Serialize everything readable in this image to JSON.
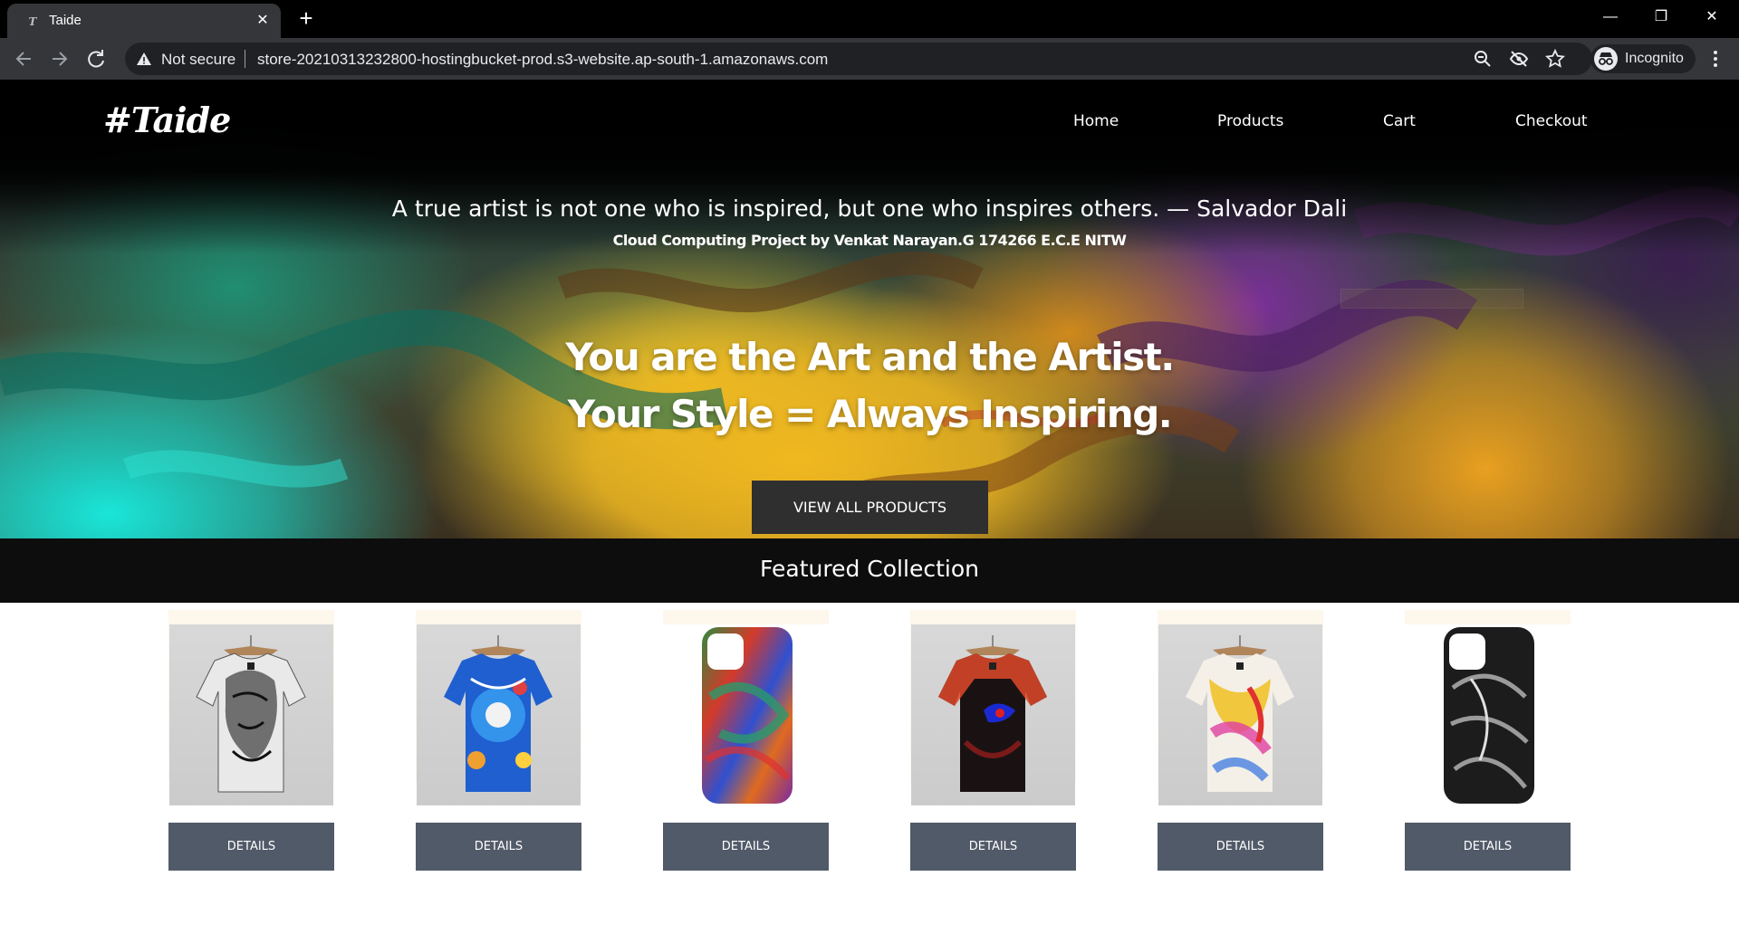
{
  "browser": {
    "tab_title": "Taide",
    "tab_favicon": "T",
    "close_tab": "✕",
    "new_tab": "+",
    "window_controls": {
      "minimize": "—",
      "restore": "❐",
      "close": "✕"
    },
    "security_label": "Not secure",
    "url": "store-20210313232800-hostingbucket-prod.s3-website.ap-south-1.amazonaws.com",
    "profile_label": "Incognito",
    "icons": [
      "back-arrow-icon",
      "forward-arrow-icon",
      "reload-icon",
      "warning-icon",
      "zoom-icon",
      "eye-off-icon",
      "star-icon",
      "incognito-icon",
      "more-menu-icon"
    ]
  },
  "site": {
    "logo": "#Taide",
    "nav": [
      "Home",
      "Products",
      "Cart",
      "Checkout"
    ],
    "hero": {
      "quote": "A true artist is not one who is inspired, but one who inspires others. — Salvador Dali",
      "credit": "Cloud Computing Project by Venkat Narayan.G 174266 E.C.E NITW",
      "headline_line1": "You are the Art and the Artist.",
      "headline_line2": "Your Style = Always Inspiring.",
      "cta": "VIEW ALL PRODUCTS"
    },
    "featured_title": "Featured Collection",
    "products": [
      {
        "kind": "tshirt",
        "style": "monochrome portrait",
        "details_label": "DETAILS"
      },
      {
        "kind": "tshirt",
        "style": "blue pattern",
        "details_label": "DETAILS"
      },
      {
        "kind": "phone-case",
        "style": "rainbow swirl",
        "details_label": "DETAILS"
      },
      {
        "kind": "tshirt",
        "style": "dark face art",
        "details_label": "DETAILS"
      },
      {
        "kind": "tshirt",
        "style": "colorful paint",
        "details_label": "DETAILS"
      },
      {
        "kind": "phone-case",
        "style": "black and white",
        "details_label": "DETAILS"
      }
    ],
    "colors": {
      "header_bg": "#000000",
      "featured_bar_bg": "#0d0d0d",
      "cta_bg": "#2f2f2f",
      "details_bg": "#515a68",
      "card_bg": "#fdf7ec"
    }
  }
}
